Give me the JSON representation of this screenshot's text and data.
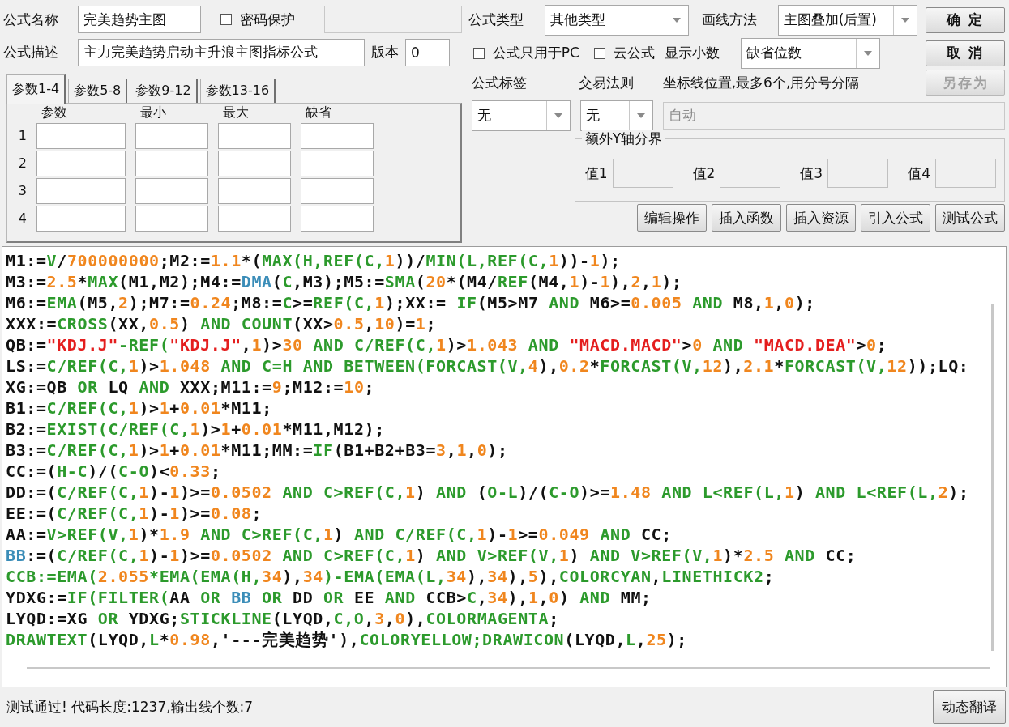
{
  "formula_name": {
    "label": "公式名称",
    "value": "完美趋势主图"
  },
  "password_protect": {
    "label": "密码保护",
    "checked": false
  },
  "password_field": {
    "disabled": true
  },
  "description": {
    "label": "公式描述",
    "value": "主力完美趋势启动主升浪主图指标公式"
  },
  "version": {
    "label": "版本",
    "value": "0"
  },
  "param_tabs": [
    {
      "label": "参数1-4",
      "selected": true
    },
    {
      "label": "参数5-8",
      "selected": false
    },
    {
      "label": "参数9-12",
      "selected": false
    },
    {
      "label": "参数13-16",
      "selected": false
    }
  ],
  "param_table": {
    "columns": [
      "参数",
      "最小",
      "最大",
      "缺省"
    ],
    "rows": [
      "1",
      "2",
      "3",
      "4"
    ]
  },
  "formula_type": {
    "label": "公式类型",
    "value": "其他类型"
  },
  "draw_method": {
    "label": "画线方法",
    "value": "主图叠加(后置)"
  },
  "options": [
    {
      "label": "公式只用于PC",
      "checked": false
    },
    {
      "label": "云公式",
      "checked": false
    }
  ],
  "decimals": {
    "label": "显示小数",
    "value": "缺省位数"
  },
  "formula_tag": {
    "label": "公式标签",
    "value": "无"
  },
  "trade_rule": {
    "label": "交易法则",
    "value": "无"
  },
  "axis_lines": {
    "label": "坐标线位置,最多6个,用分号分隔",
    "value": "自动",
    "disabled": true
  },
  "y_axis_group": {
    "title": "额外Y轴分界",
    "fields": [
      "值1",
      "值2",
      "值3",
      "值4"
    ]
  },
  "side_buttons": [
    {
      "label": "确 定",
      "disabled": false
    },
    {
      "label": "取 消",
      "disabled": false
    },
    {
      "label": "另存为",
      "disabled": true
    }
  ],
  "tool_buttons": [
    "编辑操作",
    "插入函数",
    "插入资源",
    "引入公式",
    "测试公式"
  ],
  "code_lines": [
    [
      {
        "text": "M1:=",
        "kind": "plain"
      },
      {
        "text": "V",
        "kind": "function"
      },
      {
        "text": "/",
        "kind": "plain"
      },
      {
        "text": "700000000",
        "kind": "number"
      },
      {
        "text": ";M2:=",
        "kind": "plain"
      },
      {
        "text": "1.1",
        "kind": "number"
      },
      {
        "text": "*(",
        "kind": "plain"
      },
      {
        "text": "MAX(H,REF(C,",
        "kind": "function"
      },
      {
        "text": "1",
        "kind": "number"
      },
      {
        "text": "))/",
        "kind": "plain"
      },
      {
        "text": "MIN(L,REF(C,",
        "kind": "function"
      },
      {
        "text": "1",
        "kind": "number"
      },
      {
        "text": "))-",
        "kind": "plain"
      },
      {
        "text": "1",
        "kind": "number"
      },
      {
        "text": ");",
        "kind": "plain"
      }
    ],
    [
      {
        "text": "M3:=",
        "kind": "plain"
      },
      {
        "text": "2.5",
        "kind": "number"
      },
      {
        "text": "*",
        "kind": "plain"
      },
      {
        "text": "MAX",
        "kind": "function"
      },
      {
        "text": "(M1,M2);M4:=",
        "kind": "plain"
      },
      {
        "text": "DMA",
        "kind": "user"
      },
      {
        "text": "(",
        "kind": "plain"
      },
      {
        "text": "C",
        "kind": "function"
      },
      {
        "text": ",M3);M5:=",
        "kind": "plain"
      },
      {
        "text": "SMA",
        "kind": "function"
      },
      {
        "text": "(",
        "kind": "plain"
      },
      {
        "text": "20",
        "kind": "number"
      },
      {
        "text": "*(M4/",
        "kind": "plain"
      },
      {
        "text": "REF",
        "kind": "function"
      },
      {
        "text": "(M4,",
        "kind": "plain"
      },
      {
        "text": "1",
        "kind": "number"
      },
      {
        "text": ")-",
        "kind": "plain"
      },
      {
        "text": "1",
        "kind": "number"
      },
      {
        "text": "),",
        "kind": "plain"
      },
      {
        "text": "2",
        "kind": "number"
      },
      {
        "text": ",",
        "kind": "plain"
      },
      {
        "text": "1",
        "kind": "number"
      },
      {
        "text": ");",
        "kind": "plain"
      }
    ],
    [
      {
        "text": "M6:=",
        "kind": "plain"
      },
      {
        "text": "EMA",
        "kind": "function"
      },
      {
        "text": "(M5,",
        "kind": "plain"
      },
      {
        "text": "2",
        "kind": "number"
      },
      {
        "text": ");M7:=",
        "kind": "plain"
      },
      {
        "text": "0.24",
        "kind": "number"
      },
      {
        "text": ";M8:=",
        "kind": "plain"
      },
      {
        "text": "C",
        "kind": "function"
      },
      {
        "text": ">=",
        "kind": "plain"
      },
      {
        "text": "REF(C,",
        "kind": "function"
      },
      {
        "text": "1",
        "kind": "number"
      },
      {
        "text": ");XX:= ",
        "kind": "plain"
      },
      {
        "text": "IF",
        "kind": "function"
      },
      {
        "text": "(M5>M7 ",
        "kind": "plain"
      },
      {
        "text": "AND",
        "kind": "function"
      },
      {
        "text": " M6>=",
        "kind": "plain"
      },
      {
        "text": "0.005",
        "kind": "number"
      },
      {
        "text": " AND",
        "kind": "function"
      },
      {
        "text": " M8,",
        "kind": "plain"
      },
      {
        "text": "1",
        "kind": "number"
      },
      {
        "text": ",",
        "kind": "plain"
      },
      {
        "text": "0",
        "kind": "number"
      },
      {
        "text": ");",
        "kind": "plain"
      }
    ],
    [
      {
        "text": "XXX:=",
        "kind": "plain"
      },
      {
        "text": "CROSS",
        "kind": "function"
      },
      {
        "text": "(XX,",
        "kind": "plain"
      },
      {
        "text": "0.5",
        "kind": "number"
      },
      {
        "text": ") ",
        "kind": "plain"
      },
      {
        "text": "AND COUNT",
        "kind": "function"
      },
      {
        "text": "(XX>",
        "kind": "plain"
      },
      {
        "text": "0.5",
        "kind": "number"
      },
      {
        "text": ",",
        "kind": "plain"
      },
      {
        "text": "10",
        "kind": "number"
      },
      {
        "text": ")=",
        "kind": "plain"
      },
      {
        "text": "1",
        "kind": "number"
      },
      {
        "text": ";",
        "kind": "plain"
      }
    ],
    [
      {
        "text": "QB:=",
        "kind": "plain"
      },
      {
        "text": "\"KDJ.J\"",
        "kind": "string"
      },
      {
        "text": "-REF(",
        "kind": "function"
      },
      {
        "text": "\"KDJ.J\"",
        "kind": "string"
      },
      {
        "text": ",",
        "kind": "plain"
      },
      {
        "text": "1",
        "kind": "number"
      },
      {
        "text": ")>",
        "kind": "plain"
      },
      {
        "text": "30",
        "kind": "number"
      },
      {
        "text": " AND C/REF(C,",
        "kind": "function"
      },
      {
        "text": "1",
        "kind": "number"
      },
      {
        "text": ")>",
        "kind": "plain"
      },
      {
        "text": "1.043",
        "kind": "number"
      },
      {
        "text": " AND ",
        "kind": "function"
      },
      {
        "text": "\"MACD.MACD\"",
        "kind": "string"
      },
      {
        "text": ">",
        "kind": "plain"
      },
      {
        "text": "0",
        "kind": "number"
      },
      {
        "text": " AND ",
        "kind": "function"
      },
      {
        "text": "\"MACD.DEA\"",
        "kind": "string"
      },
      {
        "text": ">",
        "kind": "plain"
      },
      {
        "text": "0",
        "kind": "number"
      },
      {
        "text": ";",
        "kind": "plain"
      }
    ],
    [
      {
        "text": "LS:=",
        "kind": "plain"
      },
      {
        "text": "C/REF(C,",
        "kind": "function"
      },
      {
        "text": "1",
        "kind": "number"
      },
      {
        "text": ")>",
        "kind": "plain"
      },
      {
        "text": "1.048",
        "kind": "number"
      },
      {
        "text": " AND C=H AND BETWEEN(FORCAST(V,",
        "kind": "function"
      },
      {
        "text": "4",
        "kind": "number"
      },
      {
        "text": "),",
        "kind": "plain"
      },
      {
        "text": "0.2",
        "kind": "number"
      },
      {
        "text": "*",
        "kind": "plain"
      },
      {
        "text": "FORCAST(V,",
        "kind": "function"
      },
      {
        "text": "12",
        "kind": "number"
      },
      {
        "text": "),",
        "kind": "plain"
      },
      {
        "text": "2.1",
        "kind": "number"
      },
      {
        "text": "*",
        "kind": "plain"
      },
      {
        "text": "FORCAST(V,",
        "kind": "function"
      },
      {
        "text": "12",
        "kind": "number"
      },
      {
        "text": "));LQ:",
        "kind": "plain"
      }
    ],
    [
      {
        "text": "XG:=QB ",
        "kind": "plain"
      },
      {
        "text": "OR",
        "kind": "function"
      },
      {
        "text": " LQ ",
        "kind": "plain"
      },
      {
        "text": "AND",
        "kind": "function"
      },
      {
        "text": " XXX;M11:=",
        "kind": "plain"
      },
      {
        "text": "9",
        "kind": "number"
      },
      {
        "text": ";M12:=",
        "kind": "plain"
      },
      {
        "text": "10",
        "kind": "number"
      },
      {
        "text": ";",
        "kind": "plain"
      }
    ],
    [
      {
        "text": "B1:=",
        "kind": "plain"
      },
      {
        "text": "C/REF(C,",
        "kind": "function"
      },
      {
        "text": "1",
        "kind": "number"
      },
      {
        "text": ")>",
        "kind": "plain"
      },
      {
        "text": "1",
        "kind": "number"
      },
      {
        "text": "+",
        "kind": "plain"
      },
      {
        "text": "0.01",
        "kind": "number"
      },
      {
        "text": "*M11;",
        "kind": "plain"
      }
    ],
    [
      {
        "text": "B2:=",
        "kind": "plain"
      },
      {
        "text": "EXIST(C/REF(C,",
        "kind": "function"
      },
      {
        "text": "1",
        "kind": "number"
      },
      {
        "text": ")>",
        "kind": "plain"
      },
      {
        "text": "1",
        "kind": "number"
      },
      {
        "text": "+",
        "kind": "plain"
      },
      {
        "text": "0.01",
        "kind": "number"
      },
      {
        "text": "*M11,M12);",
        "kind": "plain"
      }
    ],
    [
      {
        "text": "B3:=",
        "kind": "plain"
      },
      {
        "text": "C/REF(C,",
        "kind": "function"
      },
      {
        "text": "1",
        "kind": "number"
      },
      {
        "text": ")>",
        "kind": "plain"
      },
      {
        "text": "1",
        "kind": "number"
      },
      {
        "text": "+",
        "kind": "plain"
      },
      {
        "text": "0.01",
        "kind": "number"
      },
      {
        "text": "*M11;MM:=",
        "kind": "plain"
      },
      {
        "text": "IF",
        "kind": "function"
      },
      {
        "text": "(B1+B2+B3=",
        "kind": "plain"
      },
      {
        "text": "3",
        "kind": "number"
      },
      {
        "text": ",",
        "kind": "plain"
      },
      {
        "text": "1",
        "kind": "number"
      },
      {
        "text": ",",
        "kind": "plain"
      },
      {
        "text": "0",
        "kind": "number"
      },
      {
        "text": ");",
        "kind": "plain"
      }
    ],
    [
      {
        "text": "CC:=(",
        "kind": "plain"
      },
      {
        "text": "H-C",
        "kind": "function"
      },
      {
        "text": ")/(",
        "kind": "plain"
      },
      {
        "text": "C-O",
        "kind": "function"
      },
      {
        "text": ")<",
        "kind": "plain"
      },
      {
        "text": "0.33",
        "kind": "number"
      },
      {
        "text": ";",
        "kind": "plain"
      }
    ],
    [
      {
        "text": "DD:=(",
        "kind": "plain"
      },
      {
        "text": "C/REF(C,",
        "kind": "function"
      },
      {
        "text": "1",
        "kind": "number"
      },
      {
        "text": ")-",
        "kind": "plain"
      },
      {
        "text": "1",
        "kind": "number"
      },
      {
        "text": ")>=",
        "kind": "plain"
      },
      {
        "text": "0.0502",
        "kind": "number"
      },
      {
        "text": " AND C>REF(C,",
        "kind": "function"
      },
      {
        "text": "1",
        "kind": "number"
      },
      {
        "text": ") ",
        "kind": "plain"
      },
      {
        "text": "AND",
        "kind": "function"
      },
      {
        "text": " (",
        "kind": "plain"
      },
      {
        "text": "O-L",
        "kind": "function"
      },
      {
        "text": ")/(",
        "kind": "plain"
      },
      {
        "text": "C-O",
        "kind": "function"
      },
      {
        "text": ")>=",
        "kind": "plain"
      },
      {
        "text": "1.48",
        "kind": "number"
      },
      {
        "text": " AND L<REF(L,",
        "kind": "function"
      },
      {
        "text": "1",
        "kind": "number"
      },
      {
        "text": ") ",
        "kind": "plain"
      },
      {
        "text": "AND L<REF(L,",
        "kind": "function"
      },
      {
        "text": "2",
        "kind": "number"
      },
      {
        "text": ");",
        "kind": "plain"
      }
    ],
    [
      {
        "text": "EE:=(",
        "kind": "plain"
      },
      {
        "text": "C/REF(C,",
        "kind": "function"
      },
      {
        "text": "1",
        "kind": "number"
      },
      {
        "text": ")-",
        "kind": "plain"
      },
      {
        "text": "1",
        "kind": "number"
      },
      {
        "text": ")>=",
        "kind": "plain"
      },
      {
        "text": "0.08",
        "kind": "number"
      },
      {
        "text": ";",
        "kind": "plain"
      }
    ],
    [
      {
        "text": "AA:=",
        "kind": "plain"
      },
      {
        "text": "V>REF(V,",
        "kind": "function"
      },
      {
        "text": "1",
        "kind": "number"
      },
      {
        "text": ")*",
        "kind": "plain"
      },
      {
        "text": "1.9",
        "kind": "number"
      },
      {
        "text": " AND C>REF(C,",
        "kind": "function"
      },
      {
        "text": "1",
        "kind": "number"
      },
      {
        "text": ") ",
        "kind": "plain"
      },
      {
        "text": "AND C/REF(C,",
        "kind": "function"
      },
      {
        "text": "1",
        "kind": "number"
      },
      {
        "text": ")-",
        "kind": "plain"
      },
      {
        "text": "1",
        "kind": "number"
      },
      {
        "text": ">=",
        "kind": "plain"
      },
      {
        "text": "0.049",
        "kind": "number"
      },
      {
        "text": " AND",
        "kind": "function"
      },
      {
        "text": " CC;",
        "kind": "plain"
      }
    ],
    [
      {
        "text": "BB",
        "kind": "user"
      },
      {
        "text": ":=(",
        "kind": "plain"
      },
      {
        "text": "C/REF(C,",
        "kind": "function"
      },
      {
        "text": "1",
        "kind": "number"
      },
      {
        "text": ")-",
        "kind": "plain"
      },
      {
        "text": "1",
        "kind": "number"
      },
      {
        "text": ")>=",
        "kind": "plain"
      },
      {
        "text": "0.0502",
        "kind": "number"
      },
      {
        "text": " AND C>REF(C,",
        "kind": "function"
      },
      {
        "text": "1",
        "kind": "number"
      },
      {
        "text": ") ",
        "kind": "plain"
      },
      {
        "text": "AND V>REF(V,",
        "kind": "function"
      },
      {
        "text": "1",
        "kind": "number"
      },
      {
        "text": ") ",
        "kind": "plain"
      },
      {
        "text": "AND V>REF(V,",
        "kind": "function"
      },
      {
        "text": "1",
        "kind": "number"
      },
      {
        "text": ")*",
        "kind": "plain"
      },
      {
        "text": "2.5",
        "kind": "number"
      },
      {
        "text": " AND",
        "kind": "function"
      },
      {
        "text": " CC;",
        "kind": "plain"
      }
    ],
    [
      {
        "text": "CCB:=EMA(",
        "kind": "function"
      },
      {
        "text": "2.055",
        "kind": "number"
      },
      {
        "text": "*EMA(EMA(H,",
        "kind": "function"
      },
      {
        "text": "34",
        "kind": "number"
      },
      {
        "text": "),",
        "kind": "plain"
      },
      {
        "text": "34",
        "kind": "number"
      },
      {
        "text": ")-EMA(EMA(L,",
        "kind": "function"
      },
      {
        "text": "34",
        "kind": "number"
      },
      {
        "text": "),",
        "kind": "plain"
      },
      {
        "text": "34",
        "kind": "number"
      },
      {
        "text": "),",
        "kind": "plain"
      },
      {
        "text": "5",
        "kind": "number"
      },
      {
        "text": "),",
        "kind": "plain"
      },
      {
        "text": "COLORCYAN",
        "kind": "function"
      },
      {
        "text": ",",
        "kind": "plain"
      },
      {
        "text": "LINETHICK2",
        "kind": "function"
      },
      {
        "text": ";",
        "kind": "plain"
      }
    ],
    [
      {
        "text": "YDXG:=",
        "kind": "plain"
      },
      {
        "text": "IF(FILTER(",
        "kind": "function"
      },
      {
        "text": "AA ",
        "kind": "plain"
      },
      {
        "text": "OR ",
        "kind": "function"
      },
      {
        "text": "BB",
        "kind": "user"
      },
      {
        "text": " OR ",
        "kind": "function"
      },
      {
        "text": "DD ",
        "kind": "plain"
      },
      {
        "text": "OR",
        "kind": "function"
      },
      {
        "text": " EE ",
        "kind": "plain"
      },
      {
        "text": "AND",
        "kind": "function"
      },
      {
        "text": " CCB>",
        "kind": "plain"
      },
      {
        "text": "C",
        "kind": "function"
      },
      {
        "text": ",",
        "kind": "plain"
      },
      {
        "text": "34",
        "kind": "number"
      },
      {
        "text": "),",
        "kind": "plain"
      },
      {
        "text": "1",
        "kind": "number"
      },
      {
        "text": ",",
        "kind": "plain"
      },
      {
        "text": "0",
        "kind": "number"
      },
      {
        "text": ") ",
        "kind": "plain"
      },
      {
        "text": "AND",
        "kind": "function"
      },
      {
        "text": " MM;",
        "kind": "plain"
      }
    ],
    [
      {
        "text": "LYQD:=XG ",
        "kind": "plain"
      },
      {
        "text": "OR",
        "kind": "function"
      },
      {
        "text": " YDXG;",
        "kind": "plain"
      },
      {
        "text": "STICKLINE",
        "kind": "function"
      },
      {
        "text": "(LYQD,",
        "kind": "plain"
      },
      {
        "text": "C,O",
        "kind": "function"
      },
      {
        "text": ",",
        "kind": "plain"
      },
      {
        "text": "3",
        "kind": "number"
      },
      {
        "text": ",",
        "kind": "plain"
      },
      {
        "text": "0",
        "kind": "number"
      },
      {
        "text": "),",
        "kind": "plain"
      },
      {
        "text": "COLORMAGENTA",
        "kind": "function"
      },
      {
        "text": ";",
        "kind": "plain"
      }
    ],
    [
      {
        "text": "DRAWTEXT",
        "kind": "function"
      },
      {
        "text": "(LYQD,",
        "kind": "plain"
      },
      {
        "text": "L",
        "kind": "function"
      },
      {
        "text": "*",
        "kind": "plain"
      },
      {
        "text": "0.98",
        "kind": "number"
      },
      {
        "text": ",'---完美趋势'),",
        "kind": "plain"
      },
      {
        "text": "COLORYELLOW;DRAWICON",
        "kind": "function"
      },
      {
        "text": "(LYQD,",
        "kind": "plain"
      },
      {
        "text": "L",
        "kind": "function"
      },
      {
        "text": ",",
        "kind": "plain"
      },
      {
        "text": "25",
        "kind": "number"
      },
      {
        "text": ");",
        "kind": "plain"
      }
    ]
  ],
  "status_bar": {
    "message": "测试通过! 代码长度:1237,输出线个数:7",
    "button": "动态翻译"
  }
}
